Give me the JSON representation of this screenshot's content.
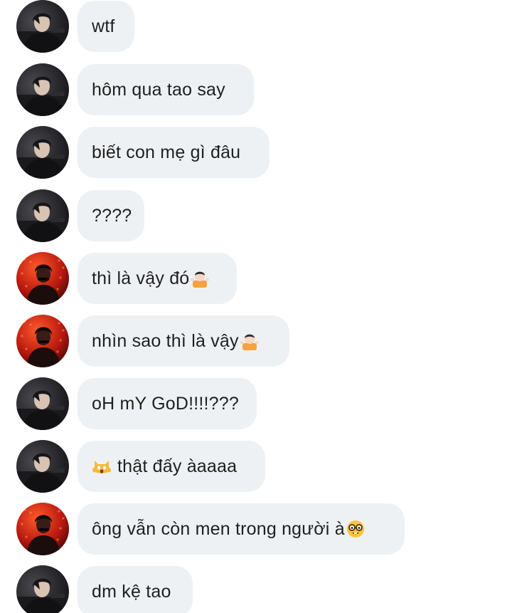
{
  "messages": [
    {
      "sender": "dark",
      "text": "wtf",
      "emoji": null
    },
    {
      "sender": "dark",
      "text": "hôm qua tao say",
      "emoji": null
    },
    {
      "sender": "dark",
      "text": "biết con mẹ gì đâu",
      "emoji": null
    },
    {
      "sender": "dark",
      "text": "????",
      "emoji": null
    },
    {
      "sender": "red",
      "text": "thì là vậy đó",
      "emoji": "person-shrugging-icon"
    },
    {
      "sender": "red",
      "text": "nhìn sao thì là vậy",
      "emoji": "person-shrugging-icon"
    },
    {
      "sender": "dark",
      "text": "oH mY GoD!!!!???",
      "emoji": null
    },
    {
      "sender": "dark",
      "text": "thật đấy àaaaa",
      "emoji": "weary-cat-icon"
    },
    {
      "sender": "red",
      "text": "ông vẫn còn men trong người à",
      "emoji": "nerd-face-icon"
    },
    {
      "sender": "dark",
      "text": "dm kệ tao",
      "emoji": null
    }
  ],
  "colors": {
    "bubble": "#eef1f4",
    "text": "#1f1f1f",
    "background": "#ffffff"
  }
}
